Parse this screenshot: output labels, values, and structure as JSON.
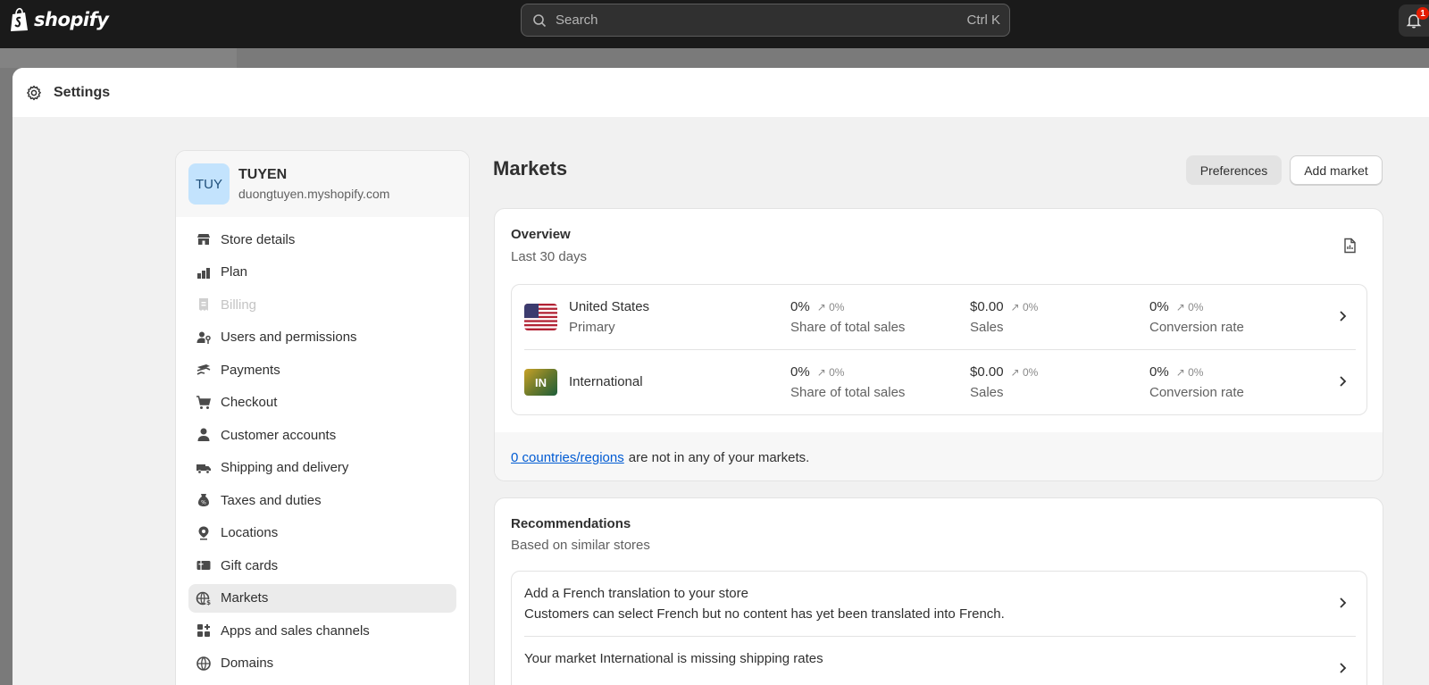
{
  "topbar": {
    "logo_text": "shopify",
    "search_placeholder": "Search",
    "search_shortcut": "Ctrl K",
    "notification_count": "1"
  },
  "panel": {
    "title": "Settings"
  },
  "store": {
    "initials": "TUY",
    "name": "TUYEN",
    "domain": "duongtuyen.myshopify.com"
  },
  "sidebar": {
    "items": [
      {
        "label": "Store details",
        "icon": "store-icon"
      },
      {
        "label": "Plan",
        "icon": "plan-icon"
      },
      {
        "label": "Billing",
        "icon": "receipt-icon",
        "disabled": true
      },
      {
        "label": "Users and permissions",
        "icon": "user-key-icon"
      },
      {
        "label": "Payments",
        "icon": "payments-icon"
      },
      {
        "label": "Checkout",
        "icon": "cart-icon"
      },
      {
        "label": "Customer accounts",
        "icon": "person-icon"
      },
      {
        "label": "Shipping and delivery",
        "icon": "truck-icon"
      },
      {
        "label": "Taxes and duties",
        "icon": "tax-icon"
      },
      {
        "label": "Locations",
        "icon": "location-icon"
      },
      {
        "label": "Gift cards",
        "icon": "gift-card-icon"
      },
      {
        "label": "Markets",
        "icon": "globe-dollar-icon",
        "active": true
      },
      {
        "label": "Apps and sales channels",
        "icon": "apps-icon"
      },
      {
        "label": "Domains",
        "icon": "globe-icon"
      }
    ]
  },
  "main": {
    "title": "Markets",
    "preferences_label": "Preferences",
    "add_market_label": "Add market"
  },
  "overview": {
    "title": "Overview",
    "subtitle": "Last 30 days",
    "markets": [
      {
        "name": "United States",
        "tag": "Primary",
        "share": "0%",
        "share_trend": "0%",
        "share_label": "Share of total sales",
        "sales": "$0.00",
        "sales_trend": "0%",
        "sales_label": "Sales",
        "conversion": "0%",
        "conversion_trend": "0%",
        "conversion_label": "Conversion rate"
      },
      {
        "name": "International",
        "badge": "IN",
        "share": "0%",
        "share_trend": "0%",
        "share_label": "Share of total sales",
        "sales": "$0.00",
        "sales_trend": "0%",
        "sales_label": "Sales",
        "conversion": "0%",
        "conversion_trend": "0%",
        "conversion_label": "Conversion rate"
      }
    ],
    "footer_link": "0 countries/regions",
    "footer_text": "are not in any of your markets."
  },
  "recommendations": {
    "title": "Recommendations",
    "subtitle": "Based on similar stores",
    "items": [
      {
        "title": "Add a French translation to your store",
        "description": "Customers can select French but no content has yet been translated into French."
      },
      {
        "title": "Your market International is missing shipping rates"
      }
    ]
  }
}
